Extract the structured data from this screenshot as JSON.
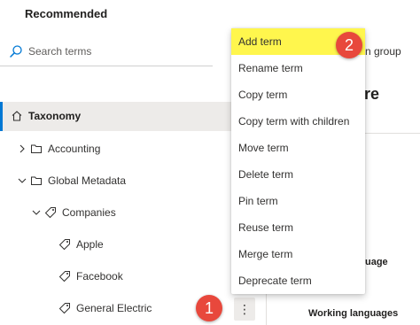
{
  "header": {
    "title": "Recommended"
  },
  "search": {
    "placeholder": "Search terms"
  },
  "tree": {
    "root": "Taxonomy",
    "items": [
      {
        "label": "Accounting"
      },
      {
        "label": "Global Metadata"
      },
      {
        "label": "Companies"
      },
      {
        "label": "Apple"
      },
      {
        "label": "Facebook"
      },
      {
        "label": "General Electric"
      }
    ]
  },
  "more_button": {
    "glyph": "⋮"
  },
  "context_menu": {
    "items": [
      "Add term",
      "Rename term",
      "Copy term",
      "Copy term with children",
      "Move term",
      "Delete term",
      "Pin term",
      "Reuse term",
      "Merge term",
      "Deprecate term"
    ],
    "highlight_color": "#fff64d"
  },
  "background": {
    "group_text": "n group",
    "bold_text": "ore",
    "language_text": "uage",
    "working_languages": "Working languages"
  },
  "callouts": {
    "first": "1",
    "second": "2",
    "color": "#e8483c"
  },
  "colors": {
    "accent": "#0078d4",
    "selected_bg": "#edebe9"
  }
}
